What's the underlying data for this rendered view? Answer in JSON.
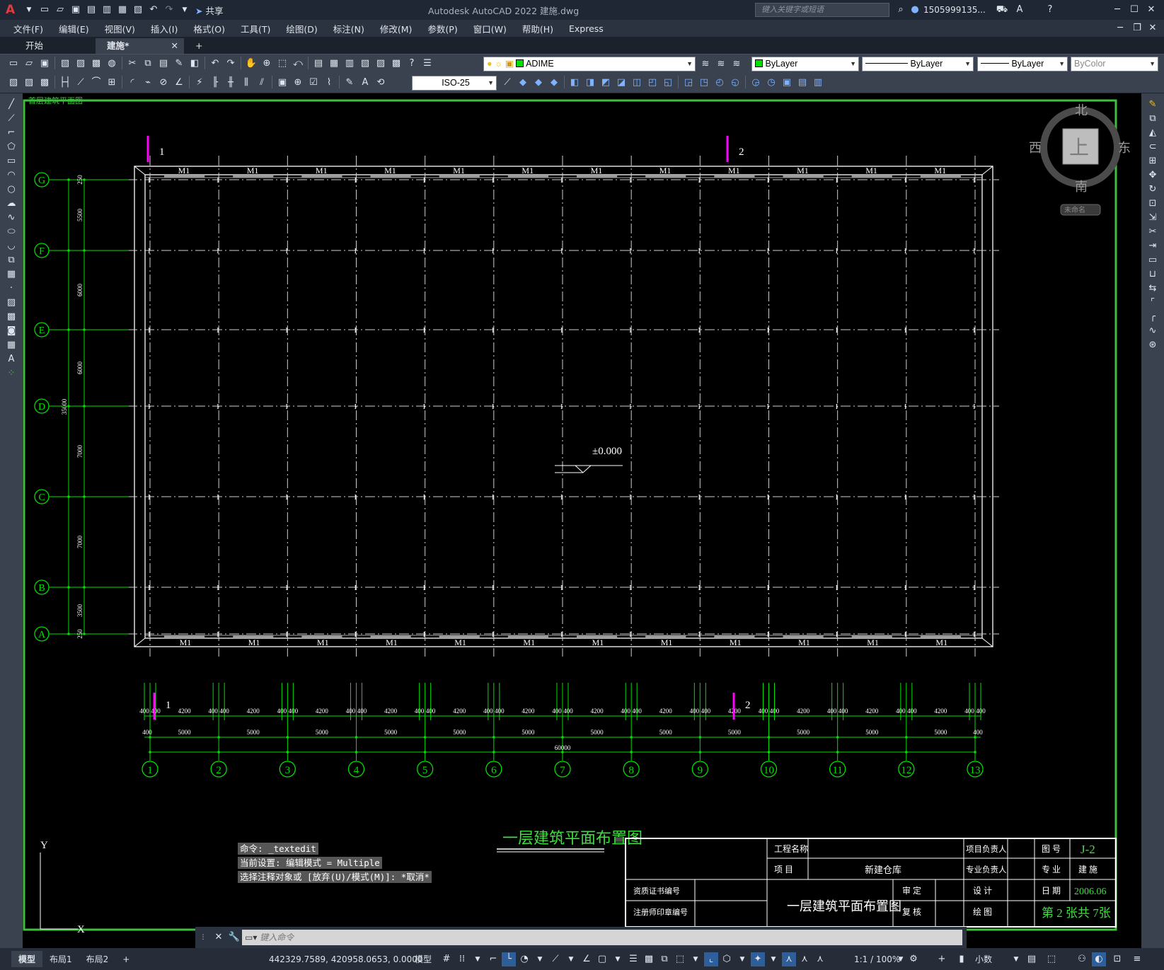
{
  "app": {
    "title": "Autodesk AutoCAD 2022    建施.dwg",
    "share_label": "共享",
    "search_placeholder": "键入关键字或短语",
    "user": "1505999135...",
    "menus": [
      "文件(F)",
      "编辑(E)",
      "视图(V)",
      "插入(I)",
      "格式(O)",
      "工具(T)",
      "绘图(D)",
      "标注(N)",
      "修改(M)",
      "参数(P)",
      "窗口(W)",
      "帮助(H)",
      "Express"
    ],
    "tabs": [
      {
        "label": "开始",
        "active": false
      },
      {
        "label": "建施*",
        "active": true
      }
    ],
    "layer": "ADIME",
    "color_bylayer": "ByLayer",
    "linetype_bylayer": "ByLayer",
    "lineweight_bylayer": "ByLayer",
    "plotstyle": "ByColor",
    "dimstyle": "ISO-25"
  },
  "viewcube": {
    "north": "北",
    "south": "南",
    "east": "东",
    "west": "西",
    "face": "上",
    "wcs": "未命名"
  },
  "drawing": {
    "top_left_label": "首层建筑平面图",
    "row_axes": [
      "G",
      "F",
      "E",
      "D",
      "C",
      "B",
      "A"
    ],
    "row_dims": [
      "250",
      "5500",
      "6000",
      "6000",
      "7000",
      "7000",
      "3500",
      "250"
    ],
    "total_vertical": "35000",
    "col_axes": [
      "1",
      "2",
      "3",
      "4",
      "5",
      "6",
      "7",
      "8",
      "9",
      "10",
      "11",
      "12",
      "13"
    ],
    "door_label": "M1",
    "elevation": "±0.000",
    "section_marks": [
      "1",
      "2"
    ],
    "dim_row1_small": "400",
    "dim_row1_big": "4200",
    "dim_row2": "5000",
    "dim_total": "60000",
    "plan_title": "一层建筑平面布置图"
  },
  "title_block": {
    "project_name_label": "工程名称",
    "project_label": "项  目",
    "project_value": "新建仓库",
    "project_lead_label": "项目负责人",
    "discipline_lead_label": "专业负责人",
    "design_label": "设  计",
    "draw_label": "绘  图",
    "review_label": "审  定",
    "check_label": "复  核",
    "drawing_no_label": "图  号",
    "drawing_no": "J-2",
    "discipline_label": "专  业",
    "discipline_value": "建  施",
    "date_label": "日  期",
    "date_value": "2006.06",
    "sheet": "第 2 张共 7张",
    "cert_label": "资质证书编号",
    "reg_label": "注册师印章编号",
    "drawing_name": "一层建筑平面布置图"
  },
  "command_history": [
    "命令: _textedit",
    "当前设置: 编辑模式 = Multiple",
    "选择注释对象或 [放弃(U)/模式(M)]: *取消*"
  ],
  "command_placeholder": "键入命令",
  "ucs": {
    "y": "Y",
    "x": "X"
  },
  "status": {
    "layout_tabs": [
      "模型",
      "布局1",
      "布局2"
    ],
    "coords": "442329.7589, 420958.0653, 0.0000",
    "mode": "模型",
    "scale": "1:1 / 100%",
    "units": "小数"
  }
}
